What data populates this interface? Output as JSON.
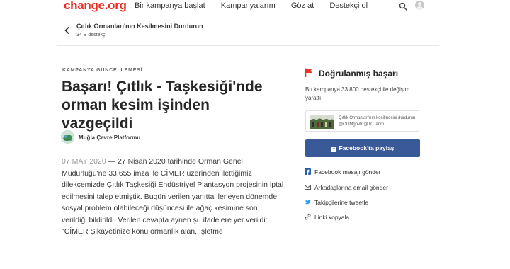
{
  "nav": {
    "logo": "change.org",
    "links": [
      "Bir kampanya başlat",
      "Kampanyalarım",
      "Göz at",
      "Destekçi ol"
    ]
  },
  "petition": {
    "title": "Çıtlık Ormanları'nın Kesilmesini Durdurun",
    "supporters": "34 B destekçi"
  },
  "article": {
    "kicker": "KAMPANYA GÜNCELLEMESİ",
    "headline": "Başarı! Çıtlık - Taşkesiği'nde orman kesim işinden vazgeçildi",
    "author": "Muğla Çevre Platformu",
    "date": "07 MAY 2020",
    "body": " — 27 Nisan 2020 tarihinde Orman Genel Müdürlüğü'ne 33.655 imza ile CİMER üzerinden ilettiğimiz dilekçemizde Çıtlık Taşkesiği Endüstriyel Plantasyon projesinin iptal edilmesini talep etmiştik. Bugün verilen yanıtta ilerleyen dönemde sosyal problem olabileceği düşüncesi ile ağaç kesimine son verildiği bildirildi. Verilen cevapta aynen şu ifadelere yer verildi: \"CİMER Şikayetinize konu ormanlık alan, İşletme"
  },
  "sidebar": {
    "verified_title": "Doğrulanmış başarı",
    "verified_desc": "Bu kampanya 33.800 destekçi ile değişim yarattı!",
    "tweet_text": "Çıtlık Ormanları'nın kesilmesini durdurun @OGMgovtr @TCTarim",
    "facebook_share": "Facebook'ta paylaş",
    "share_options": [
      "Facebook mesajı gönder",
      "Arkadaşlarına email gönder",
      "Takipçilerine tweetle",
      "Linki kopyala"
    ]
  },
  "colors": {
    "brand": "#ec2c22",
    "facebook": "#3a5998",
    "icon_blue": "#2a5fa8"
  }
}
